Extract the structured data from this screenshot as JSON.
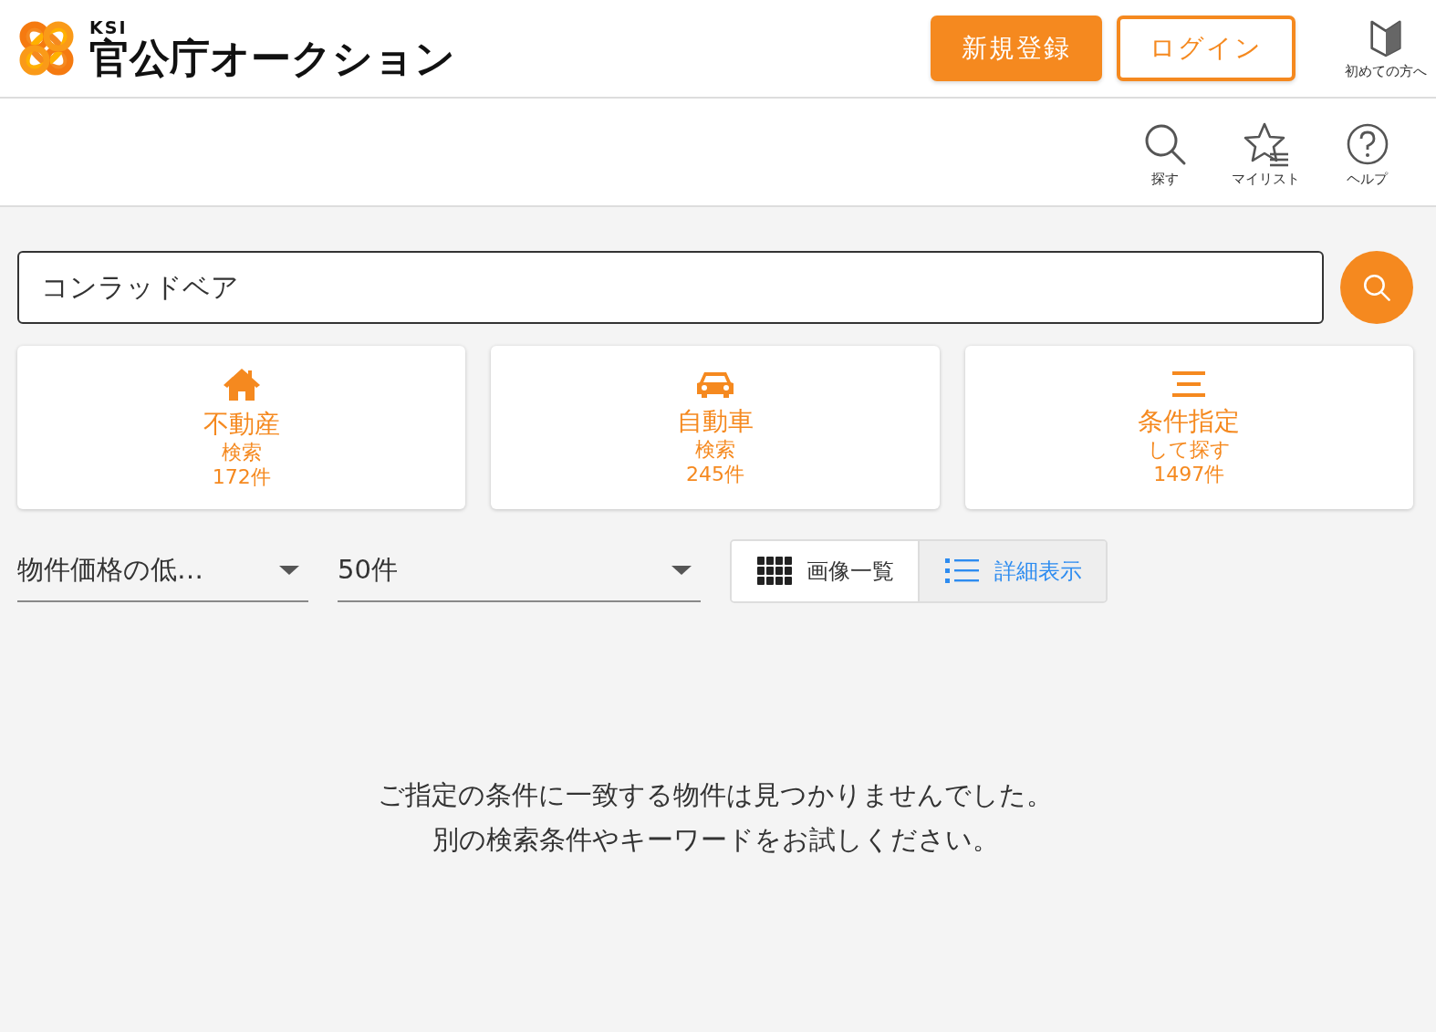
{
  "logo": {
    "brand": "KSI",
    "title": "官公庁オークション"
  },
  "header_buttons": [
    {
      "kind": "primary",
      "label": "新規登録"
    },
    {
      "kind": "outline",
      "label": "ログイン"
    }
  ],
  "beginner_link": {
    "label": "初めての方へ"
  },
  "nav": [
    {
      "kind": "search",
      "label": "探す"
    },
    {
      "kind": "mylist",
      "label": "マイリスト"
    },
    {
      "kind": "help",
      "label": "ヘルプ"
    }
  ],
  "search": {
    "value": "コンラッドベア"
  },
  "categories": [
    {
      "kind": "house",
      "title": "不動産",
      "subtitle": "検索",
      "count": "172件"
    },
    {
      "kind": "car",
      "title": "自動車",
      "subtitle": "検索",
      "count": "245件"
    },
    {
      "kind": "filter",
      "title": "条件指定",
      "subtitle": "して探す",
      "count": "1497件"
    }
  ],
  "sort": {
    "value": "物件価格の低…"
  },
  "per_page": {
    "value": "50件"
  },
  "view_toggle": [
    {
      "kind": "grid",
      "label": "画像一覧",
      "selected": false
    },
    {
      "kind": "list",
      "label": "詳細表示",
      "selected": true
    }
  ],
  "message": [
    "ご指定の条件に一致する物件は見つかりませんでした。",
    "別の検索条件やキーワードをお試しください。"
  ]
}
